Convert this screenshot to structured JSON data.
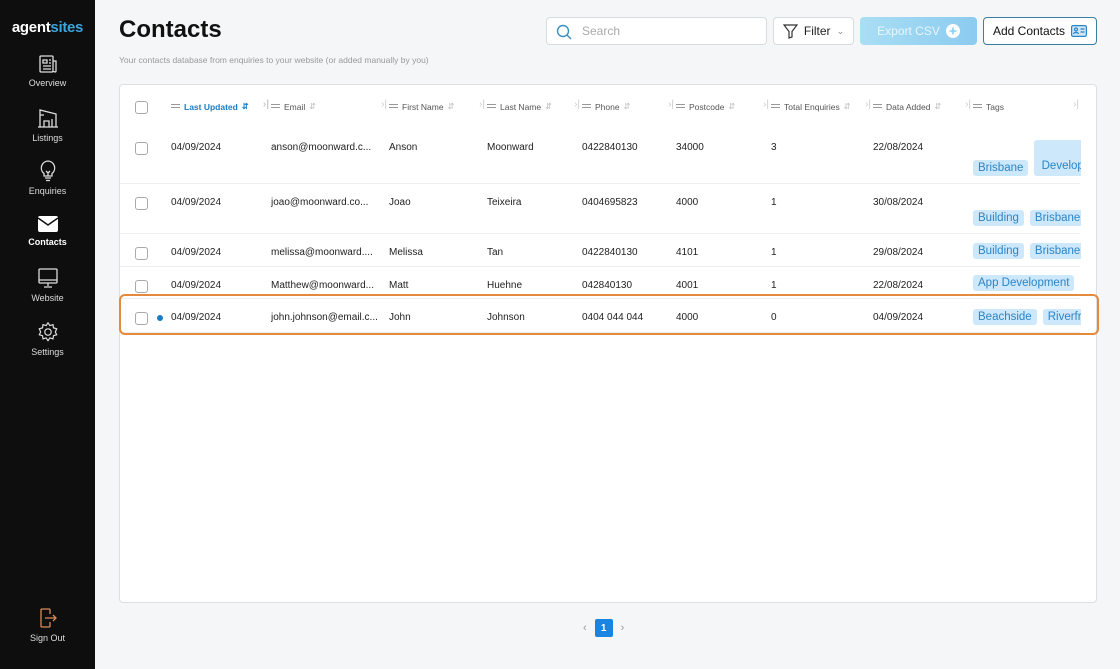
{
  "sidebar": {
    "logo_part1": "agent",
    "logo_part2": "sites",
    "items": [
      {
        "label": "Overview",
        "icon": "newspaper-icon"
      },
      {
        "label": "Listings",
        "icon": "building-icon"
      },
      {
        "label": "Enquiries",
        "icon": "lightbulb-icon"
      },
      {
        "label": "Contacts",
        "icon": "envelope-icon",
        "active": true
      },
      {
        "label": "Website",
        "icon": "monitor-icon"
      },
      {
        "label": "Settings",
        "icon": "gear-icon"
      }
    ],
    "signout": "Sign Out"
  },
  "header": {
    "title": "Contacts",
    "subtitle": "Your contacts database from enquiries to your website (or added manually by you)",
    "search_placeholder": "Search",
    "filter_label": "Filter",
    "export_label": "Export CSV",
    "add_label": "Add Contacts"
  },
  "colors": {
    "accent": "#1a7cc4",
    "highlight": "#e38a3c",
    "tag_bg": "#cde7fb",
    "tag_text": "#2b85c6"
  },
  "table": {
    "columns": [
      "Last Updated",
      "Email",
      "First Name",
      "Last Name",
      "Phone",
      "Postcode",
      "Total Enquiries",
      "Data Added",
      "Tags"
    ],
    "rows": [
      {
        "updated": "04/09/2024",
        "email": "anson@moonward.c...",
        "first": "Anson",
        "last": "Moonward",
        "phone": "0422840130",
        "postcode": "34000",
        "enquiries": "3",
        "added": "22/08/2024",
        "tags": [
          "Brisbane",
          "App Development"
        ]
      },
      {
        "updated": "04/09/2024",
        "email": "joao@moonward.co...",
        "first": "Joao",
        "last": "Teixeira",
        "phone": "0404695823",
        "postcode": "4000",
        "enquiries": "1",
        "added": "30/08/2024",
        "tags": [
          "Building",
          "Brisbane"
        ]
      },
      {
        "updated": "04/09/2024",
        "email": "melissa@moonward....",
        "first": "Melissa",
        "last": "Tan",
        "phone": "0422840130",
        "postcode": "4101",
        "enquiries": "1",
        "added": "29/08/2024",
        "tags": [
          "Building",
          "Brisbane"
        ]
      },
      {
        "updated": "04/09/2024",
        "email": "Matthew@moonward...",
        "first": "Matt",
        "last": "Huehne",
        "phone": "042840130",
        "postcode": "4001",
        "enquiries": "1",
        "added": "22/08/2024",
        "tags": [
          "App Development"
        ]
      },
      {
        "updated": "04/09/2024",
        "email": "john.johnson@email.c...",
        "first": "John",
        "last": "Johnson",
        "phone": "0404 044 044",
        "postcode": "4000",
        "enquiries": "0",
        "added": "04/09/2024",
        "tags": [
          "Beachside",
          "Riverfront"
        ],
        "new": true
      }
    ]
  },
  "pagination": {
    "current": "1"
  }
}
